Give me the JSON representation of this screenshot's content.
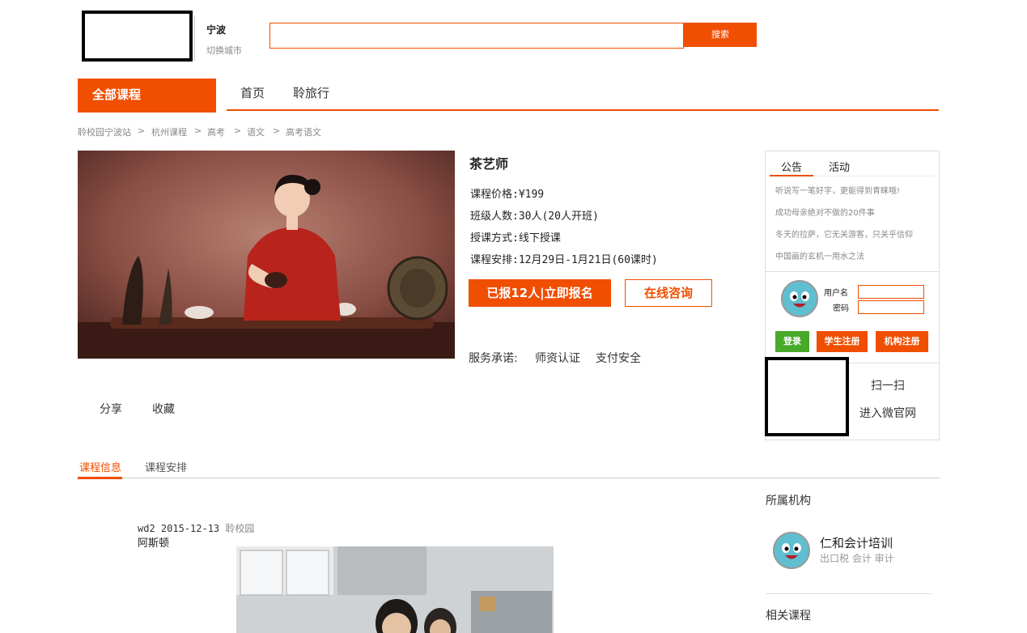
{
  "header": {
    "city_name": "宁波",
    "city_switch": "切换城市",
    "search_value": "",
    "search_button": "搜索"
  },
  "nav": {
    "all_courses": "全部课程",
    "items": [
      "首页",
      "聆旅行"
    ]
  },
  "breadcrumb": [
    "聆校园宁波站",
    "杭州课程",
    "高考",
    "语文",
    "高考语文"
  ],
  "breadcrumb_sep": ">",
  "course": {
    "title": "茶艺师",
    "price": "课程价格:¥199",
    "class_size": "班级人数:30人(20人开班)",
    "mode": "授课方式:线下授课",
    "schedule": "课程安排:12月29日-1月21日(60课时)",
    "enroll_button": "已报12人|立即报名",
    "consult_button": "在线咨询",
    "service_label": "服务承诺:",
    "service_items": [
      "师资认证",
      "支付安全"
    ]
  },
  "actions": {
    "share": "分享",
    "favorite": "收藏"
  },
  "sidebar": {
    "tabs": [
      "公告",
      "活动"
    ],
    "news": [
      "听说写一笔好字，更能得到青睐哦!",
      "成功母亲绝对不做的20件事",
      "冬天的拉萨，它无关游客，只关乎信仰",
      "中国画的玄机一用水之法"
    ],
    "login": {
      "username_label": "用户名",
      "password_label": "密码",
      "login_button": "登录",
      "student_register": "学生注册",
      "org_register": "机构注册"
    },
    "qr": {
      "line1": "扫一扫",
      "line2": "进入微官网"
    },
    "org_section_title": "所属机构",
    "org": {
      "name": "仁和会计培训",
      "tags": "出口税 会计 审计"
    },
    "related_title": "相关课程"
  },
  "detail_tabs": [
    "课程信息",
    "课程安排"
  ],
  "post": {
    "meta": "wd2 2015-12-13",
    "source": "聆校园",
    "author": "阿斯顿"
  },
  "colors": {
    "accent": "#f04e00",
    "green": "#49a92a"
  }
}
